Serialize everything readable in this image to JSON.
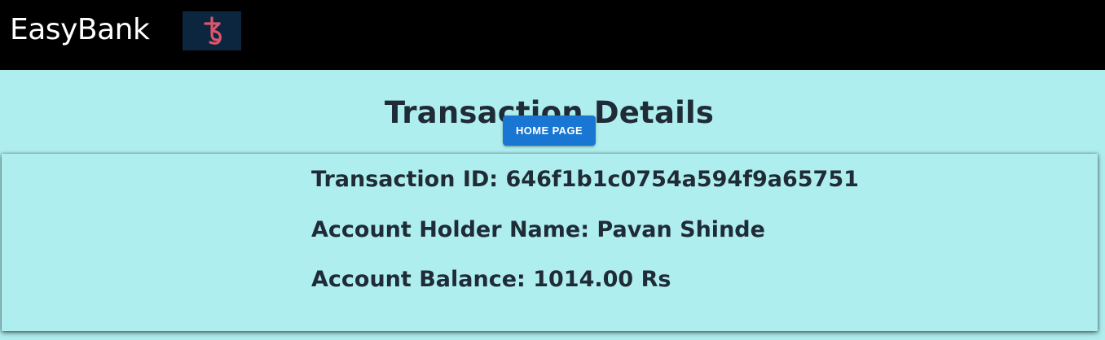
{
  "navbar": {
    "brand": "EasyBank",
    "logo_icon": "tezos-logo-icon"
  },
  "page": {
    "title": "Transaction Details",
    "home_button_label": "HOME PAGE"
  },
  "details": {
    "transaction_id": "Transaction ID: 646f1b1c0754a594f9a65751",
    "account_holder": "Account Holder Name: Pavan Shinde",
    "account_balance": "Account Balance: 1014.00 Rs"
  },
  "colors": {
    "navbar_bg": "#000000",
    "page_bg": "#afeeee",
    "button_bg": "#1976d2",
    "text": "#1f2b36",
    "logo_bg": "#0d2640",
    "logo_fg": "#d9566b"
  }
}
